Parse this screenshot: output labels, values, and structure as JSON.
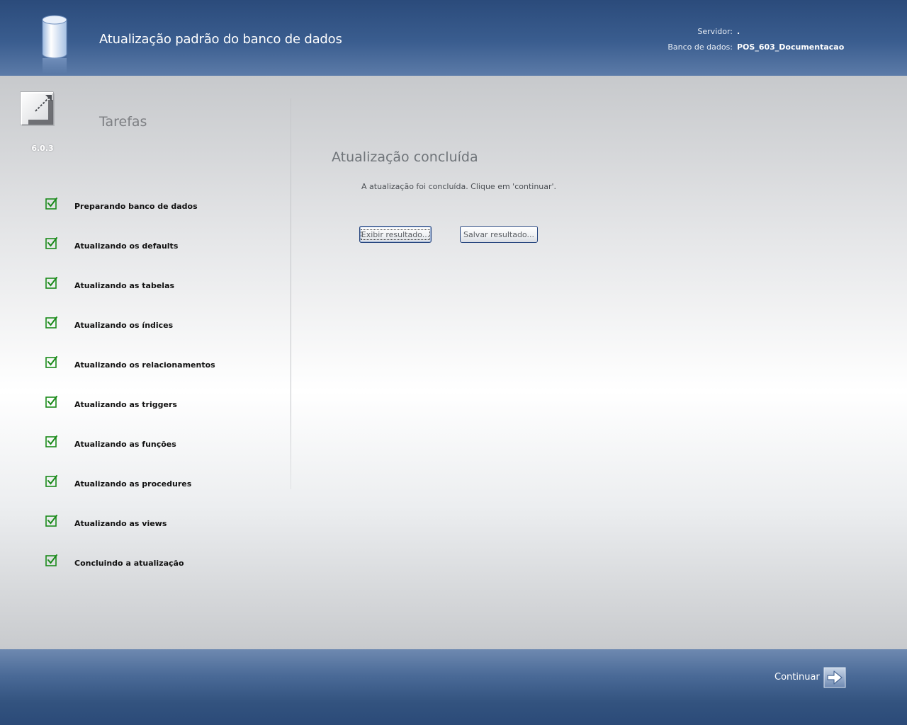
{
  "header": {
    "title": "Atualização padrão do banco de dados",
    "server_label": "Servidor:",
    "server_value": ".",
    "database_label": "Banco de dados:",
    "database_value": "POS_603_Documentacao",
    "icon": "database-cylinder-icon"
  },
  "sidebar": {
    "title": "Tarefas",
    "version": "6.0.3",
    "logo_icon": "resize-arrow-logo-icon",
    "tasks": [
      {
        "label": "Preparando banco de dados",
        "done": true
      },
      {
        "label": "Atualizando os defaults",
        "done": true
      },
      {
        "label": "Atualizando as tabelas",
        "done": true
      },
      {
        "label": "Atualizando os índices",
        "done": true
      },
      {
        "label": "Atualizando os relacionamentos",
        "done": true
      },
      {
        "label": "Atualizando as triggers",
        "done": true
      },
      {
        "label": "Atualizando as funções",
        "done": true
      },
      {
        "label": "Atualizando as procedures",
        "done": true
      },
      {
        "label": "Atualizando as views",
        "done": true
      },
      {
        "label": "Concluindo a atualização",
        "done": true
      }
    ]
  },
  "main": {
    "status_title": "Atualização concluída",
    "status_message": "A atualização foi concluída. Clique em 'continuar'.",
    "show_button": "Exibir resultado...",
    "save_button": "Salvar resultado..."
  },
  "footer": {
    "continue_label": "Continuar",
    "continue_icon": "arrow-right-icon"
  },
  "colors": {
    "header_blue": "#2b4b7b",
    "check_green": "#1a8a1a",
    "button_border": "#27467f"
  }
}
